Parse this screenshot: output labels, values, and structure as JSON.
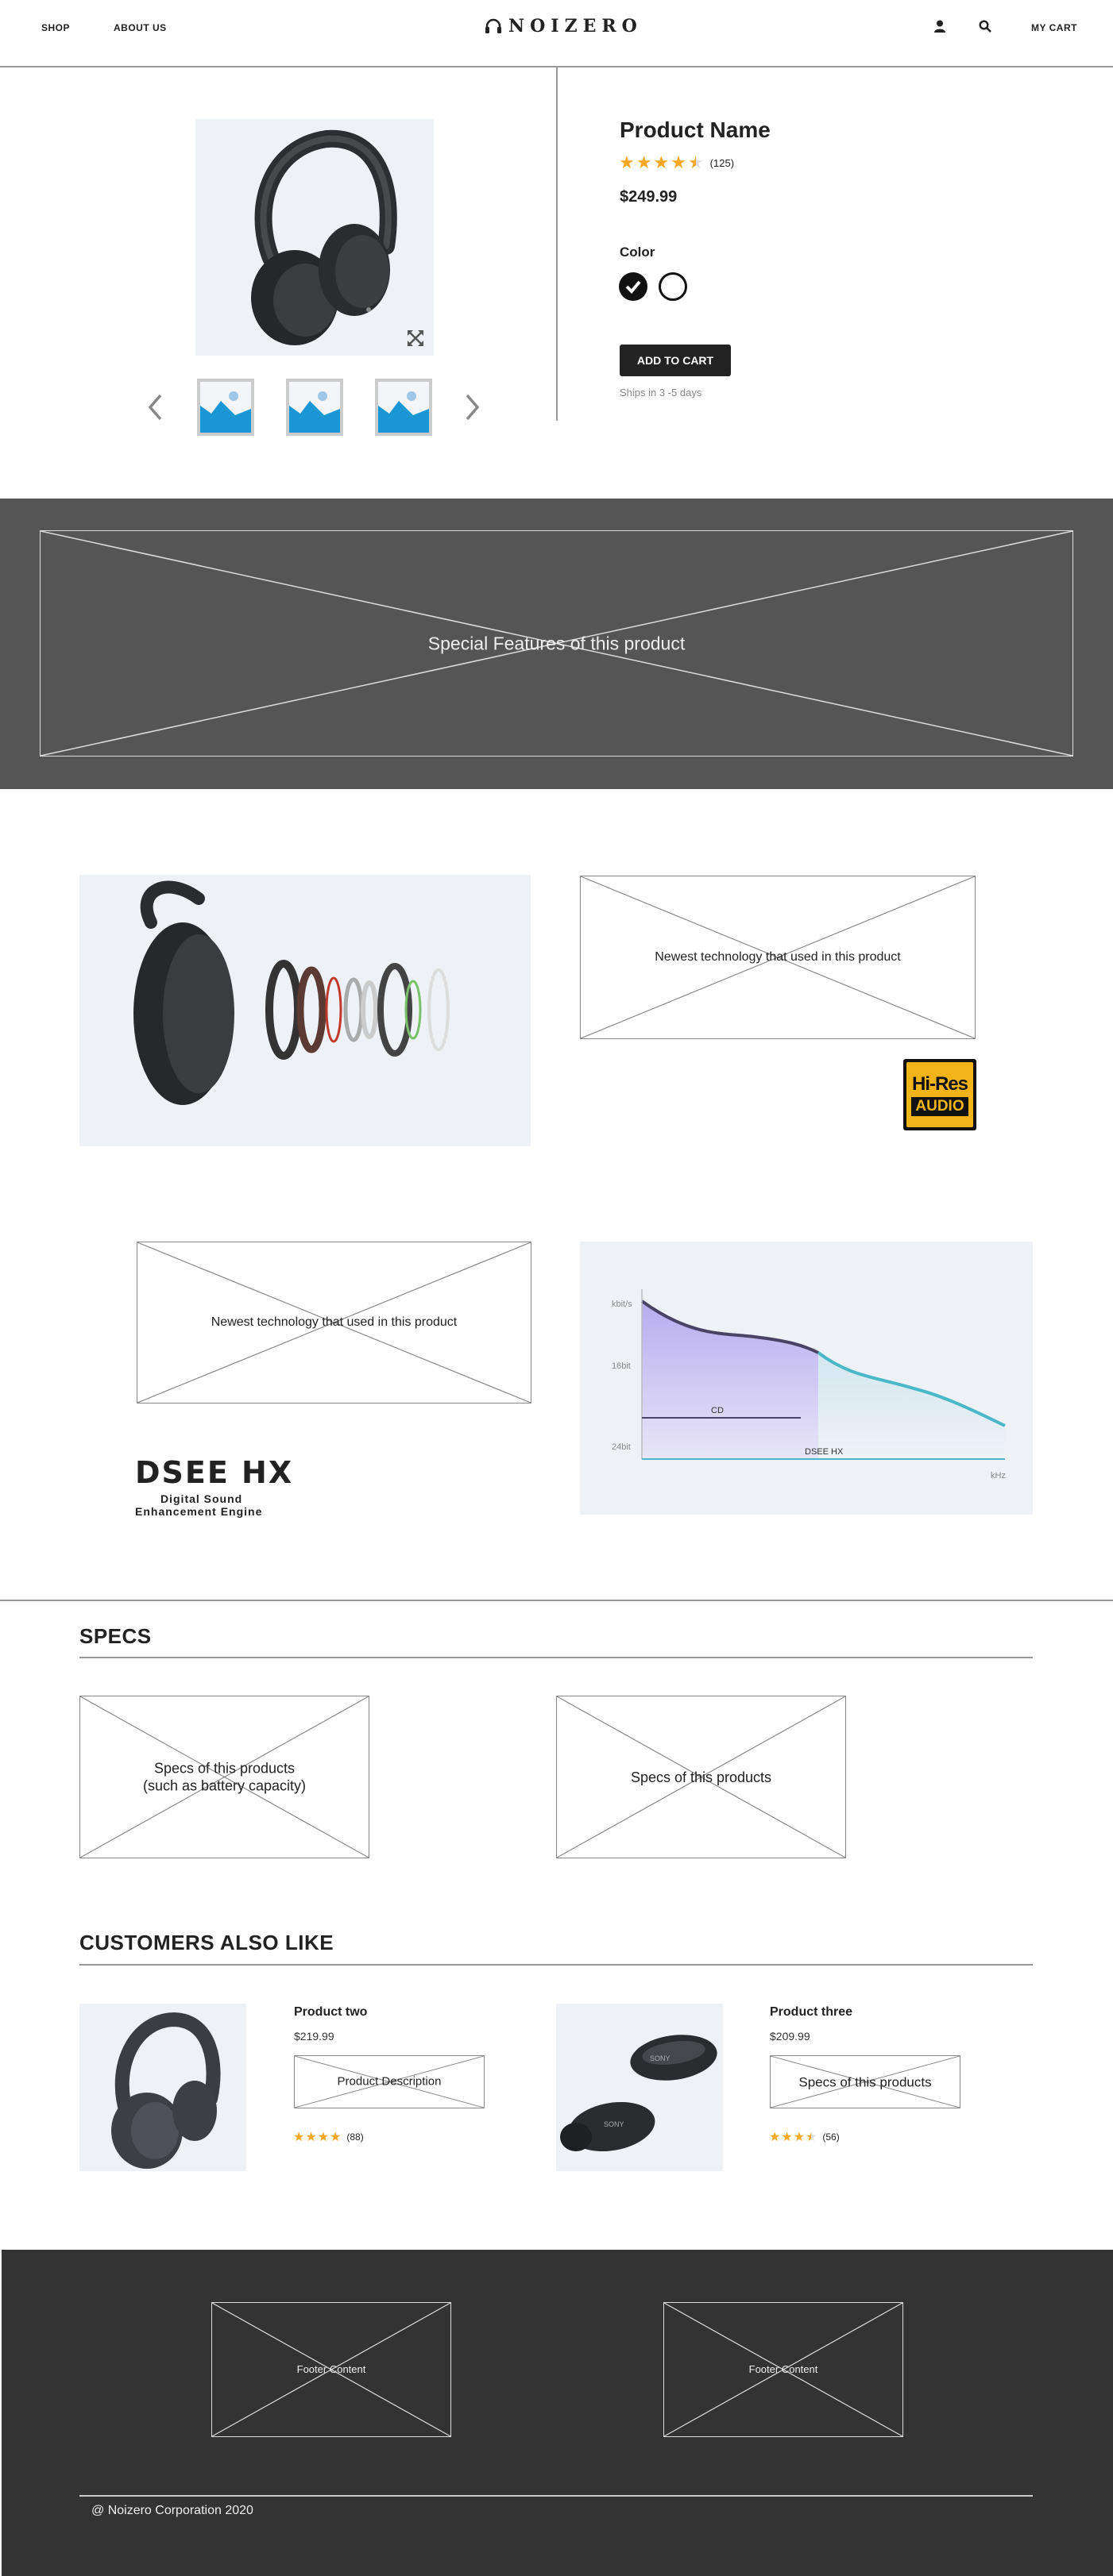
{
  "header": {
    "nav": [
      "SHOP",
      "ABOUT US"
    ],
    "logo": "NOIZERO",
    "cart": "MY CART"
  },
  "product": {
    "name": "Product Name",
    "rating": 4.5,
    "reviews": "(125)",
    "price": "$249.99",
    "color_label": "Color",
    "colors": [
      "#111111",
      "#ffffff"
    ],
    "add_to_cart": "ADD TO CART",
    "shipping": "Ships in 3 -5 days"
  },
  "features": {
    "banner": "Special Features of this product",
    "tech1": "Newest technology that used in this product",
    "tech2": "Newest technology that used in this product",
    "hires_top": "Hi-Res",
    "hires_bottom": "AUDIO",
    "dsee_title": "DSEE HX",
    "dsee_sub1": "Digital Sound",
    "dsee_sub2": "Enhancement Engine",
    "graph": {
      "y_labels": [
        "kbit/s",
        "16bit",
        "24bit"
      ],
      "x_label": "kHz",
      "cd": "CD",
      "dsee": "DSEE HX"
    }
  },
  "specs": {
    "title": "SPECS",
    "box1": "Specs of this products\n(such as battery capacity)",
    "box2": "Specs of this products"
  },
  "customers": {
    "title": "CUSTOMERS ALSO LIKE",
    "items": [
      {
        "name": "Product two",
        "price": "$219.99",
        "desc": "Product Description",
        "rating": 4,
        "reviews": "(88)"
      },
      {
        "name": "Product three",
        "price": "$209.99",
        "desc": "Specs of this products",
        "rating": 3.5,
        "reviews": "(56)"
      }
    ]
  },
  "footer": {
    "box1": "Footer Content",
    "box2": "Footer Content",
    "copyright": "@ Noizero Corporation 2020"
  },
  "colors": {
    "accent_star": "#f5a623",
    "dark_band": "#555555",
    "footer_bg": "#333333",
    "hires_gold": "#f2b418"
  }
}
